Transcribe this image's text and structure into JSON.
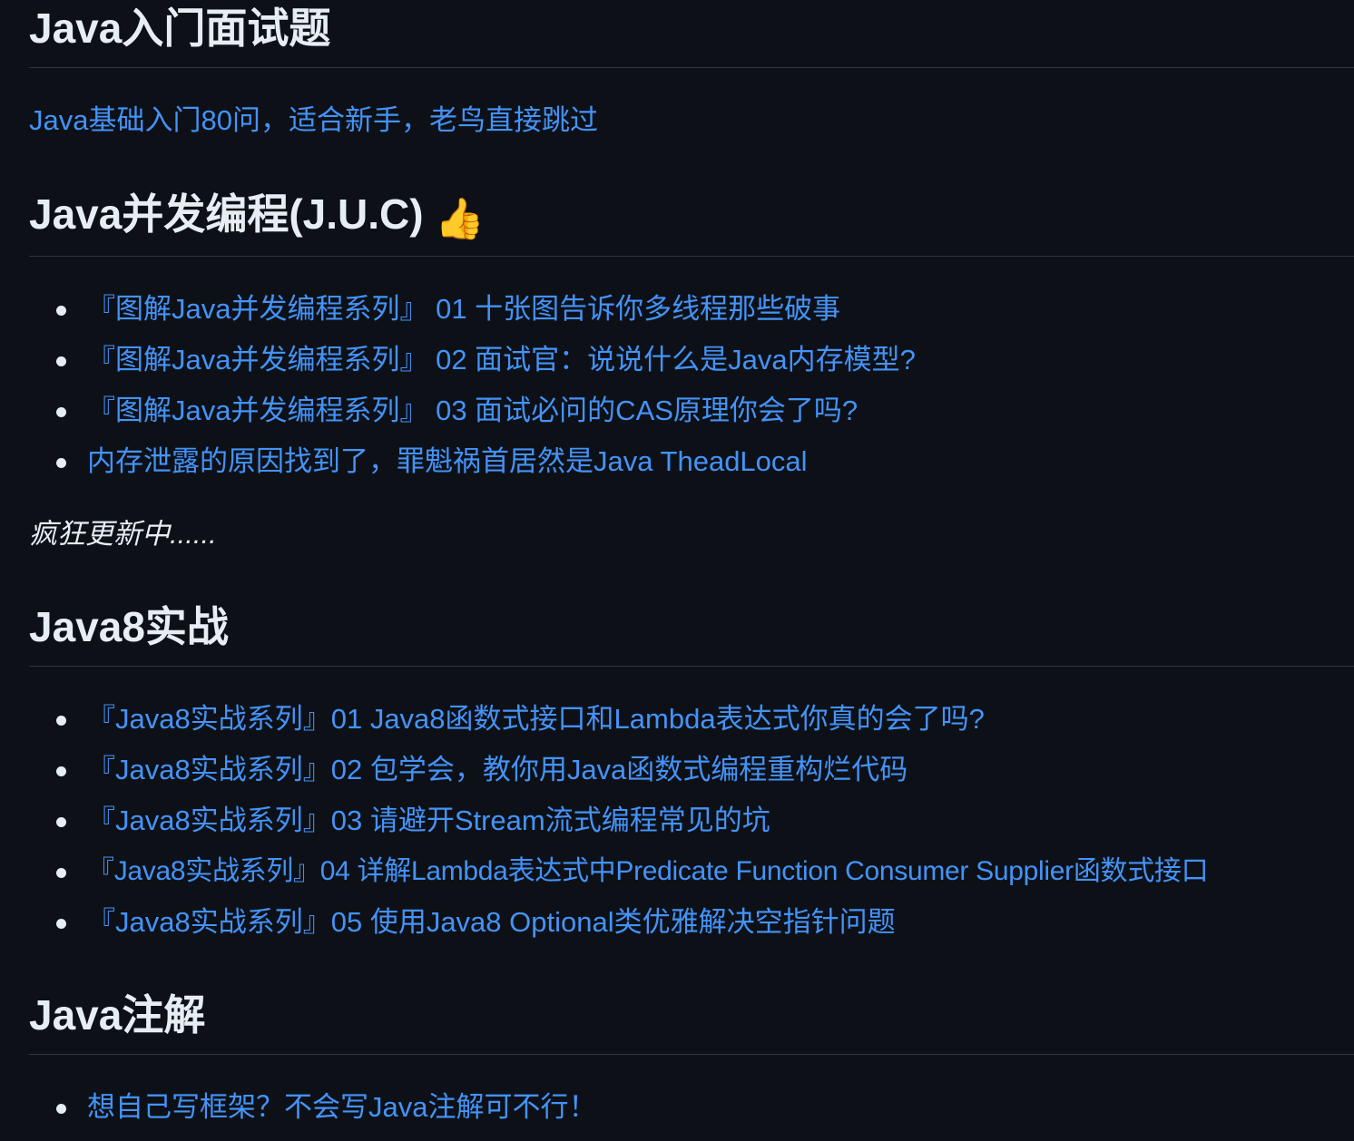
{
  "sections": [
    {
      "title": "Java入门面试题",
      "intro_link": "Java基础入门80问，适合新手，老鸟直接跳过"
    },
    {
      "title": "Java并发编程(J.U.C)",
      "icon": "thumbs-up-icon",
      "icon_glyph": "👍",
      "items": [
        "『图解Java并发编程系列』 01 十张图告诉你多线程那些破事",
        "『图解Java并发编程系列』 02 面试官：说说什么是Java内存模型?",
        "『图解Java并发编程系列』 03 面试必问的CAS原理你会了吗?",
        "内存泄露的原因找到了，罪魁祸首居然是Java TheadLocal"
      ],
      "note": "疯狂更新中......"
    },
    {
      "title": "Java8实战",
      "items": [
        "『Java8实战系列』01 Java8函数式接口和Lambda表达式你真的会了吗?",
        "『Java8实战系列』02 包学会，教你用Java函数式编程重构烂代码",
        "『Java8实战系列』03 请避开Stream流式编程常见的坑",
        "『Java8实战系列』04 详解Lambda表达式中Predicate Function Consumer Supplier函数式接口",
        "『Java8实战系列』05 使用Java8 Optional类优雅解决空指针问题"
      ]
    },
    {
      "title": "Java注解",
      "items": [
        "想自己写框架？不会写Java注解可不行！"
      ]
    }
  ],
  "colors": {
    "background": "#0d1117",
    "text": "#e6edf3",
    "link": "#4493f8",
    "divider": "#30363d"
  }
}
